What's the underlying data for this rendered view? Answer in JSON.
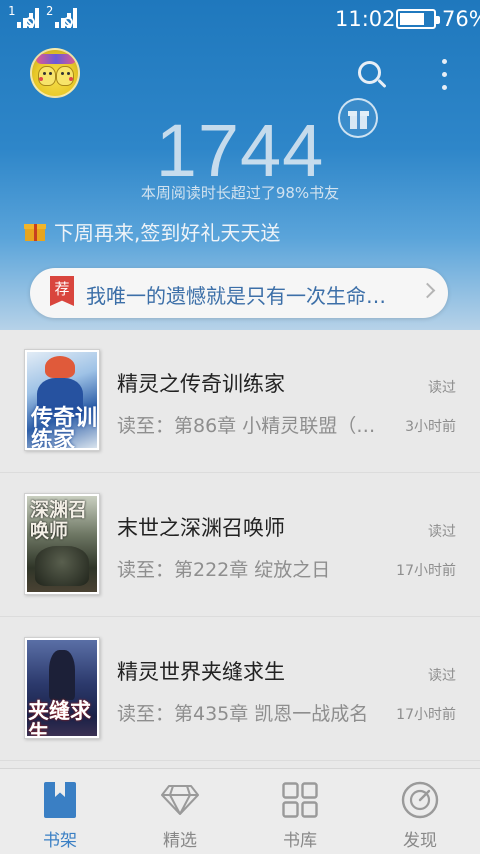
{
  "status_bar": {
    "sim1_label": "1",
    "sim2_label": "2",
    "time": "11:02",
    "battery_percent_text": "76%",
    "battery_level": 0.76
  },
  "header": {
    "avatar_icon": "user-avatar",
    "search_icon": "search-icon",
    "more_icon": "more-vertical-icon",
    "gift_icon": "gift-icon",
    "weekly_minutes": "1744",
    "weekly_caption": "本周阅读时长超过了98%书友",
    "signin_text": "下周再来,签到好礼天天送",
    "accent_color": "#2a80c4"
  },
  "recommendation": {
    "tag": "荐",
    "text": "我唯一的遗憾就是只有一次生命…",
    "tag_color": "#d9453d"
  },
  "books": [
    {
      "title": "精灵之传奇训练家",
      "status": "读过",
      "progress": "读至：第86章 小精灵联盟（…",
      "time": "3小时前",
      "cover_text": "传奇训练家"
    },
    {
      "title": "末世之深渊召唤师",
      "status": "读过",
      "progress": "读至：第222章 绽放之日",
      "time": "17小时前",
      "cover_text": "深渊召唤师"
    },
    {
      "title": "精灵世界夹缝求生",
      "status": "读过",
      "progress": "读至：第435章 凯恩一战成名",
      "time": "17小时前",
      "cover_text": "夹缝求生"
    }
  ],
  "bottom_nav": [
    {
      "label": "书架",
      "icon": "bookshelf-icon",
      "active": true
    },
    {
      "label": "精选",
      "icon": "diamond-icon",
      "active": false
    },
    {
      "label": "书库",
      "icon": "grid-icon",
      "active": false
    },
    {
      "label": "发现",
      "icon": "compass-icon",
      "active": false
    }
  ]
}
